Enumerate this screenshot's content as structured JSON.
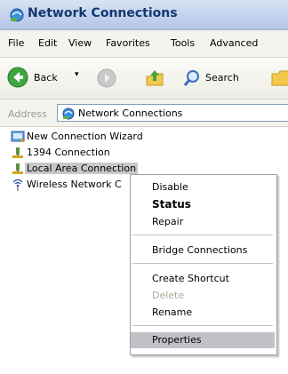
{
  "window": {
    "title": "Network Connections"
  },
  "menubar": {
    "items": [
      "File",
      "Edit",
      "View",
      "Favorites",
      "Tools",
      "Advanced"
    ]
  },
  "toolbar": {
    "back_label": "Back",
    "back_dropdown": "▾",
    "search_label": "Search"
  },
  "address": {
    "label": "Address",
    "value": "Network Connections"
  },
  "connections": [
    {
      "label": "New Connection Wizard",
      "icon": "new-connection-wizard-icon"
    },
    {
      "label": "1394 Connection",
      "icon": "lan-connection-icon"
    },
    {
      "label": "Local Area Connection",
      "icon": "lan-connection-icon",
      "selected": true
    },
    {
      "label": "Wireless Network C",
      "icon": "wireless-connection-icon"
    }
  ],
  "context_menu": {
    "items": [
      {
        "label": "Disable"
      },
      {
        "label": "Status",
        "default": true
      },
      {
        "label": "Repair"
      },
      {
        "label": "Bridge Connections"
      },
      {
        "label": "Create Shortcut"
      },
      {
        "label": "Delete",
        "disabled": true
      },
      {
        "label": "Rename"
      },
      {
        "label": "Properties",
        "highlighted": true
      }
    ]
  },
  "colors": {
    "title_text": "#14376e",
    "menu_highlight": "#c1c1c8",
    "disabled_text": "#aca899"
  }
}
